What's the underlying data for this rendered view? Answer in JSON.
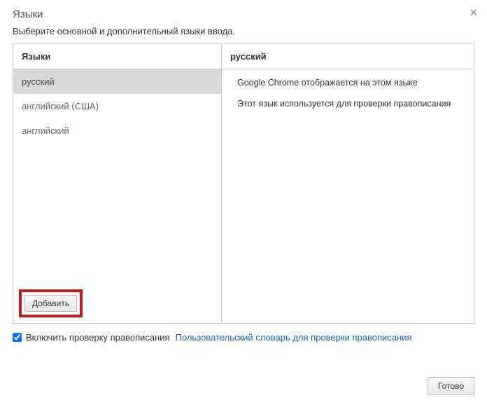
{
  "dialog": {
    "title": "Языки",
    "subtitle": "Выберите основной и дополнительный языки ввода."
  },
  "left": {
    "header": "Языки",
    "items": [
      {
        "label": "русский",
        "selected": true
      },
      {
        "label": "английский (США)",
        "selected": false
      },
      {
        "label": "английский",
        "selected": false
      }
    ],
    "add_label": "Добавить"
  },
  "right": {
    "header": "русский",
    "details": [
      "Google Chrome отображается на этом языке",
      "Этот язык используется для проверки правописания"
    ]
  },
  "spellcheck": {
    "checked": true,
    "label": "Включить проверку правописания",
    "link": "Пользовательский словарь для проверки правописания"
  },
  "footer": {
    "done_label": "Готово"
  }
}
